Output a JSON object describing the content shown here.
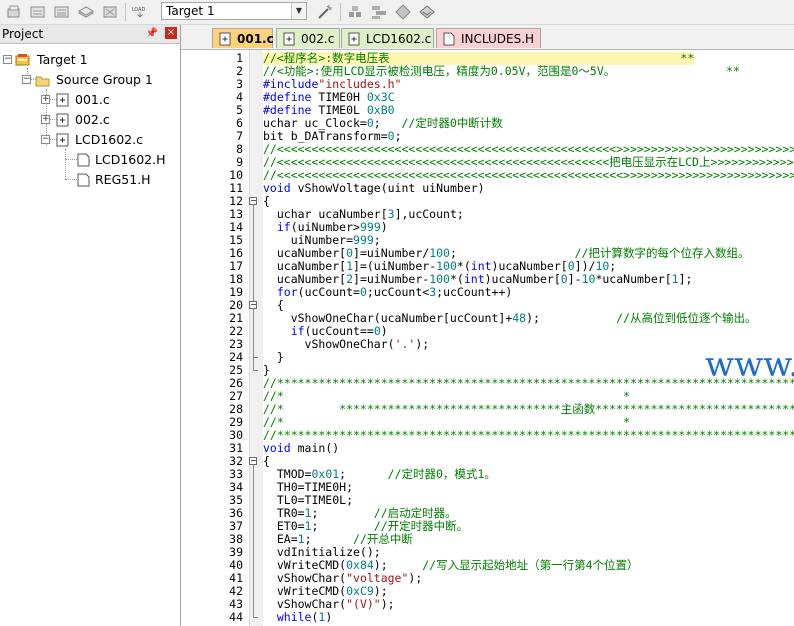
{
  "toolbar": {
    "target_select": "Target 1",
    "buttons": [
      "translate-icon",
      "build-icon",
      "rebuild-icon",
      "batch-build-icon",
      "stop-build-icon",
      "download-icon",
      "target-options-icon",
      "manage-components-icon",
      "select-packs-icon",
      "pack-installer-icon",
      "env-icon"
    ]
  },
  "project_panel": {
    "title": "Project",
    "pin": "░",
    "close": "×",
    "tree": {
      "target": "Target 1",
      "group": "Source Group 1",
      "files": [
        "001.c",
        "002.c",
        "LCD1602.c"
      ],
      "lcd_children": [
        "LCD1602.H",
        "REG51.H"
      ]
    }
  },
  "tabs": [
    {
      "label": "001.c",
      "active": true
    },
    {
      "label": "002.c",
      "active": false
    },
    {
      "label": "LCD1602.c",
      "active": false
    },
    {
      "label": "INCLUDES.H",
      "active": false
    }
  ],
  "editor": {
    "lines": [
      {
        "n": "1",
        "html": "<span class=\"c-com\">//<程序名>:数字电压表                                          **</span>"
      },
      {
        "n": "2",
        "html": "<span class=\"c-com\">//<功能>:使用LCD显示被检测电压，精度为0.05V，范围是0～5V。                **</span>"
      },
      {
        "n": "3",
        "html": "<span class=\"c-kw\">#include</span><span class=\"c-str\">\"includes.h\"</span>"
      },
      {
        "n": "4",
        "html": "<span class=\"c-kw\">#define</span> TIME0H <span class=\"c-num\">0x3C</span>"
      },
      {
        "n": "5",
        "html": "<span class=\"c-kw\">#define</span> TIME0L <span class=\"c-num\">0xB0</span>"
      },
      {
        "n": "6",
        "html": "uchar uc_Clock=<span class=\"c-num\">0</span>;   <span class=\"c-com\">//定时器0中断计数</span>"
      },
      {
        "n": "7",
        "html": "bit b_DATransform=<span class=\"c-num\">0</span>;"
      },
      {
        "n": "8",
        "html": "<span class=\"c-com\">//&lt;&lt;&lt;&lt;&lt;&lt;&lt;&lt;&lt;&lt;&lt;&lt;&lt;&lt;&lt;&lt;&lt;&lt;&lt;&lt;&lt;&lt;&lt;&lt;&lt;&lt;&lt;&lt;&lt;&lt;&lt;&lt;&lt;&lt;&lt;&lt;&lt;&lt;&lt;&lt;&lt;&lt;&lt;&lt;&lt;&lt;&lt;&lt;&lt;&gt;&gt;&gt;&gt;&gt;&gt;&gt;&gt;&gt;&gt;&gt;&gt;&gt;&gt;&gt;&gt;&gt;&gt;&gt;&gt;&gt;&gt;&gt;&gt;&gt;&gt;&gt;&gt;&gt;&gt;&gt;&gt;&gt;&gt;&gt;&gt;&gt;&gt;&gt;&gt;&gt;&gt;&gt;&gt;&gt;</span>"
      },
      {
        "n": "9",
        "html": "<span class=\"c-com\">//&lt;&lt;&lt;&lt;&lt;&lt;&lt;&lt;&lt;&lt;&lt;&lt;&lt;&lt;&lt;&lt;&lt;&lt;&lt;&lt;&lt;&lt;&lt;&lt;&lt;&lt;&lt;&lt;&lt;&lt;&lt;&lt;&lt;&lt;&lt;&lt;&lt;&lt;&lt;&lt;&lt;&lt;&lt;&lt;&lt;&lt;&lt;&lt;把电压显示在LCD上&gt;&gt;&gt;&gt;&gt;&gt;&gt;&gt;&gt;&gt;&gt;&gt;&gt;&gt;&gt;&gt;&gt;&gt;&gt;&gt;&gt;&gt;&gt;&gt;</span>"
      },
      {
        "n": "10",
        "html": "<span class=\"c-com\">//&lt;&lt;&lt;&lt;&lt;&lt;&lt;&lt;&lt;&lt;&lt;&lt;&lt;&lt;&lt;&lt;&lt;&lt;&lt;&lt;&lt;&lt;&lt;&lt;&lt;&lt;&lt;&lt;&lt;&lt;&lt;&lt;&lt;&lt;&lt;&lt;&lt;&lt;&lt;&lt;&lt;&lt;&lt;&lt;&lt;&lt;&lt;&lt;&lt;&lt;&gt;&gt;&gt;&gt;&gt;&gt;&gt;&gt;&gt;&gt;&gt;&gt;&gt;&gt;&gt;&gt;&gt;&gt;&gt;&gt;&gt;&gt;&gt;&gt;&gt;&gt;&gt;&gt;&gt;&gt;&gt;&gt;&gt;&gt;&gt;&gt;&gt;&gt;&gt;&gt;&gt;&gt;&gt;</span>"
      },
      {
        "n": "11",
        "html": "<span class=\"c-kw\">void</span> vShowVoltage(uint uiNumber)"
      },
      {
        "n": "12",
        "html": "{"
      },
      {
        "n": "13",
        "html": "  uchar ucaNumber[<span class=\"c-num\">3</span>],ucCount;"
      },
      {
        "n": "14",
        "html": "  <span class=\"c-kw\">if</span>(uiNumber&gt;<span class=\"c-num\">999</span>)"
      },
      {
        "n": "15",
        "html": "    uiNumber=<span class=\"c-num\">999</span>;"
      },
      {
        "n": "16",
        "html": "  ucaNumber[<span class=\"c-num\">0</span>]=uiNumber/<span class=\"c-num\">100</span>;                 <span class=\"c-com\">//把计算数字的每个位存入数组。</span>"
      },
      {
        "n": "17",
        "html": "  ucaNumber[<span class=\"c-num\">1</span>]=(uiNumber-<span class=\"c-num\">100</span>*(<span class=\"c-kw\">int</span>)ucaNumber[<span class=\"c-num\">0</span>])/<span class=\"c-num\">10</span>;"
      },
      {
        "n": "18",
        "html": "  ucaNumber[<span class=\"c-num\">2</span>]=uiNumber-<span class=\"c-num\">100</span>*(<span class=\"c-kw\">int</span>)ucaNumber[<span class=\"c-num\">0</span>]-<span class=\"c-num\">10</span>*ucaNumber[<span class=\"c-num\">1</span>];"
      },
      {
        "n": "19",
        "html": "  <span class=\"c-kw\">for</span>(ucCount=<span class=\"c-num\">0</span>;ucCount&lt;<span class=\"c-num\">3</span>;ucCount++)"
      },
      {
        "n": "20",
        "html": "  {"
      },
      {
        "n": "21",
        "html": "    vShowOneChar(ucaNumber[ucCount]+<span class=\"c-num\">48</span>);           <span class=\"c-com\">//从高位到低位逐个输出。</span>"
      },
      {
        "n": "22",
        "html": "    <span class=\"c-kw\">if</span>(ucCount==<span class=\"c-num\">0</span>)"
      },
      {
        "n": "23",
        "html": "      vShowOneChar(<span class=\"c-str\">'.'</span>);"
      },
      {
        "n": "24",
        "html": "  }"
      },
      {
        "n": "25",
        "html": "}"
      },
      {
        "n": "26",
        "html": "<span class=\"c-com\">//*********************************************************************************************</span>"
      },
      {
        "n": "27",
        "html": "<span class=\"c-com\">//*                                                 *</span>"
      },
      {
        "n": "28",
        "html": "<span class=\"c-com\">//*        ********************************主函数*************************************</span>"
      },
      {
        "n": "29",
        "html": "<span class=\"c-com\">//*                                                 *</span>"
      },
      {
        "n": "30",
        "html": "<span class=\"c-com\">//*********************************************************************************************</span>"
      },
      {
        "n": "31",
        "html": "<span class=\"c-kw\">void</span> main()"
      },
      {
        "n": "32",
        "html": "{"
      },
      {
        "n": "33",
        "html": "  TMOD=<span class=\"c-num\">0x01</span>;      <span class=\"c-com\">//定时器0，模式1。</span>"
      },
      {
        "n": "34",
        "html": "  TH0=TIME0H;"
      },
      {
        "n": "35",
        "html": "  TL0=TIME0L;"
      },
      {
        "n": "36",
        "html": "  TR0=<span class=\"c-num\">1</span>;        <span class=\"c-com\">//启动定时器。</span>"
      },
      {
        "n": "37",
        "html": "  ET0=<span class=\"c-num\">1</span>;        <span class=\"c-com\">//开定时器中断。</span>"
      },
      {
        "n": "38",
        "html": "  EA=<span class=\"c-num\">1</span>;      <span class=\"c-com\">//开总中断</span>"
      },
      {
        "n": "39",
        "html": "  vdInitialize();"
      },
      {
        "n": "40",
        "html": "  vWriteCMD(<span class=\"c-num\">0x84</span>);     <span class=\"c-com\">//写入显示起始地址（第一行第4个位置）</span>"
      },
      {
        "n": "41",
        "html": "  vShowChar(<span class=\"c-str\">\"voltage\"</span>);"
      },
      {
        "n": "42",
        "html": "  vWriteCMD(<span class=\"c-num\">0xC9</span>);"
      },
      {
        "n": "43",
        "html": "  vShowChar(<span class=\"c-str\">\"(V)\"</span>);"
      },
      {
        "n": "44",
        "html": "  <span class=\"c-kw\">while</span>(<span class=\"c-num\">1</span>)"
      }
    ]
  },
  "watermark": "www.elecfans.com",
  "watermark_visible": "www.eleck.com"
}
